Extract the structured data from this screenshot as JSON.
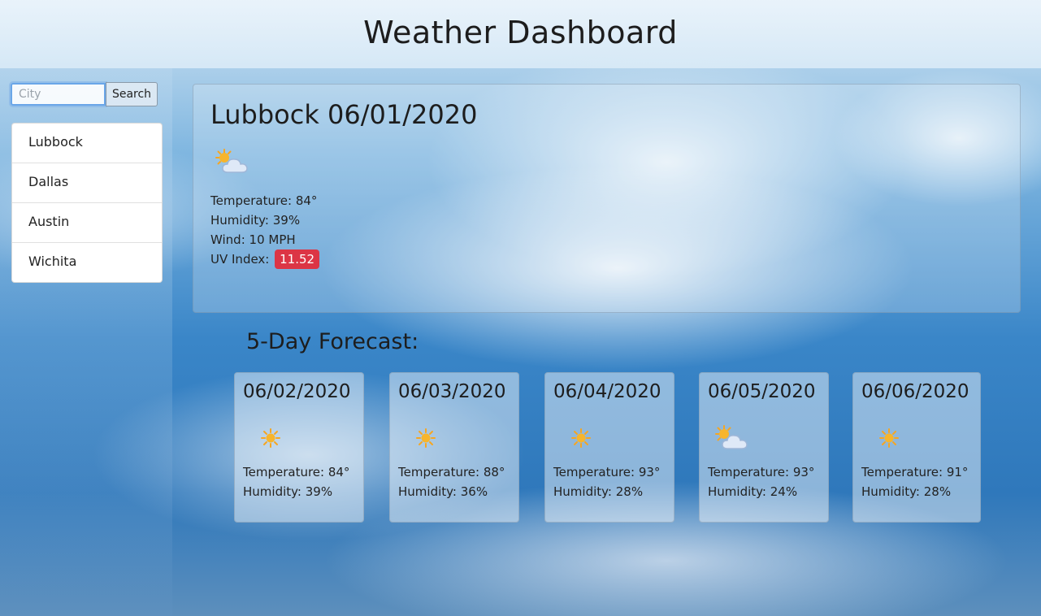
{
  "header": {
    "title": "Weather Dashboard"
  },
  "search": {
    "placeholder": "City",
    "value": "",
    "button_label": "Search"
  },
  "cities": [
    "Lubbock",
    "Dallas",
    "Austin",
    "Wichita"
  ],
  "current": {
    "title": "Lubbock 06/01/2020",
    "icon": "sun-cloud-icon",
    "temperature": "Temperature: 84°",
    "humidity": "Humidity: 39%",
    "wind": "Wind: 10 MPH",
    "uv_label": "UV Index:",
    "uv_value": "11.52",
    "uv_color": "#dc3545"
  },
  "forecast": {
    "heading": "5-Day Forecast:",
    "days": [
      {
        "date": "06/02/2020",
        "icon": "sun-icon",
        "temperature": "Temperature: 84°",
        "humidity": "Humidity: 39%"
      },
      {
        "date": "06/03/2020",
        "icon": "sun-icon",
        "temperature": "Temperature: 88°",
        "humidity": "Humidity: 36%"
      },
      {
        "date": "06/04/2020",
        "icon": "sun-icon",
        "temperature": "Temperature: 93°",
        "humidity": "Humidity: 28%"
      },
      {
        "date": "06/05/2020",
        "icon": "sun-cloud-icon",
        "temperature": "Temperature: 93°",
        "humidity": "Humidity: 24%"
      },
      {
        "date": "06/06/2020",
        "icon": "sun-icon",
        "temperature": "Temperature: 91°",
        "humidity": "Humidity: 28%"
      }
    ]
  }
}
